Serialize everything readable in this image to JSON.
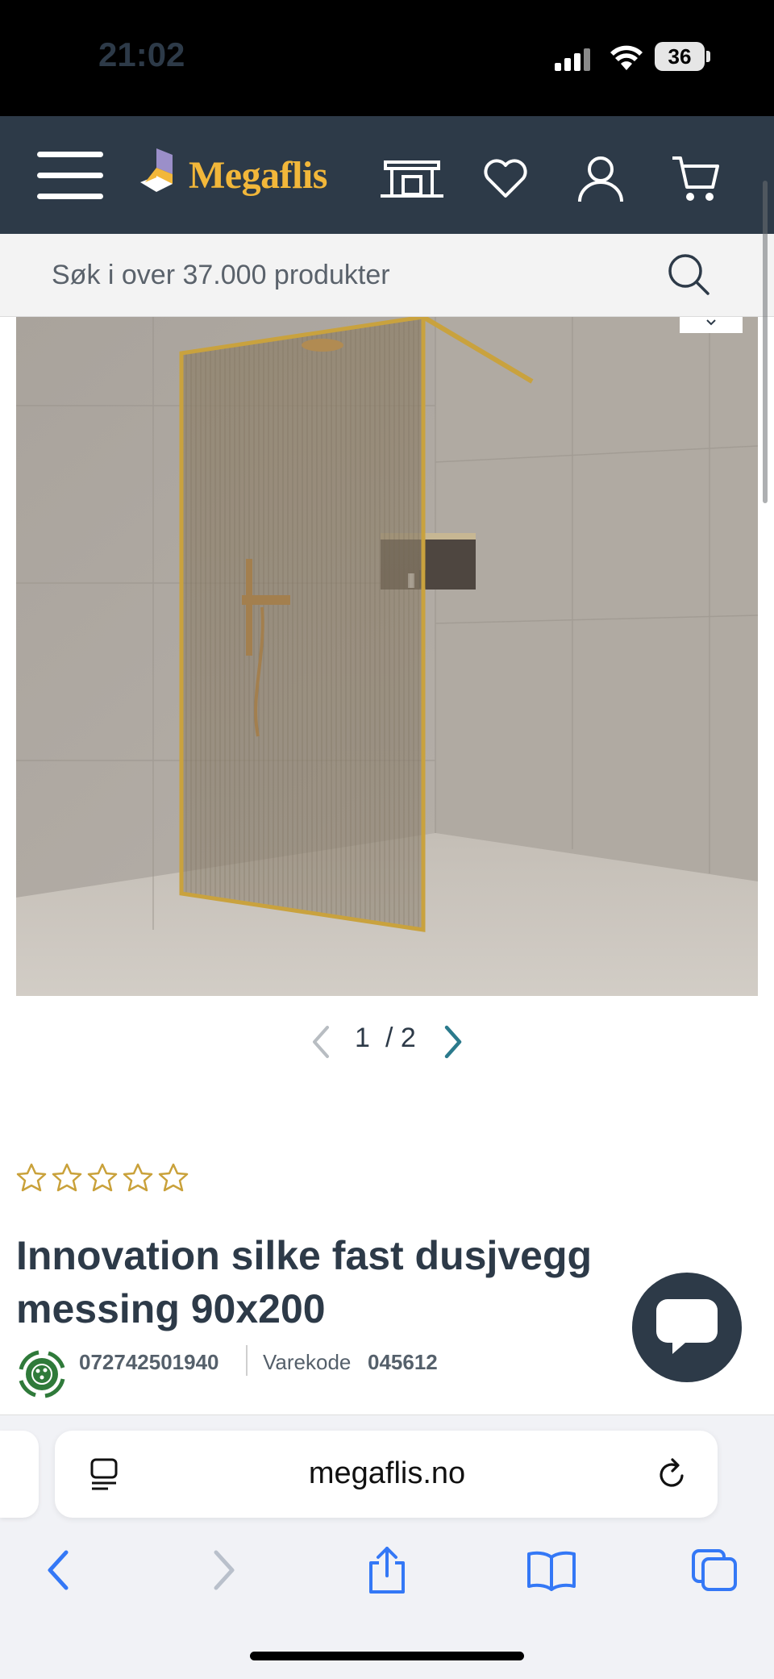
{
  "status_bar": {
    "time": "21:02",
    "battery": "36"
  },
  "header": {
    "logo_text": "Megaflis",
    "icons": [
      "menu-icon",
      "store-icon",
      "heart-icon",
      "user-icon",
      "cart-icon"
    ]
  },
  "search": {
    "placeholder": "Søk i over 37.000 produkter"
  },
  "gallery": {
    "current": "1",
    "separator": "/ 2"
  },
  "product": {
    "rating_stars": 0,
    "rating_max": 5,
    "title": "Innovation silke fast dusjvegg messing 90x200",
    "ean": "072742501940",
    "varekode_label": "Varekode",
    "varekode_value": "045612"
  },
  "browser": {
    "url": "megaflis.no"
  },
  "colors": {
    "header_bg": "#2d3a48",
    "logo_gold": "#f2b73a",
    "accent_teal": "#2b7a8c",
    "star_gold": "#c9a13a"
  }
}
